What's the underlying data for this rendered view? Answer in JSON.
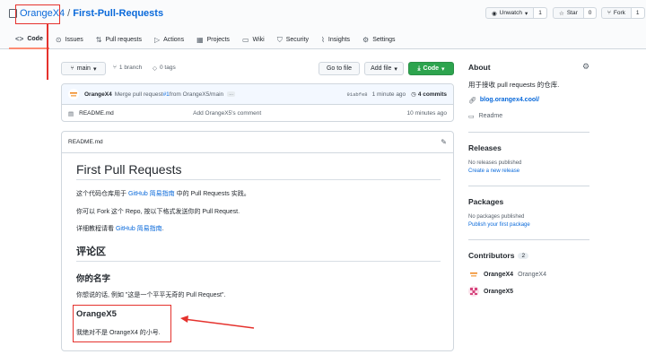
{
  "header": {
    "owner": "OrangeX4",
    "separator": "/",
    "repo": "First-Pull-Requests",
    "unwatch_label": "Unwatch",
    "unwatch_count": "1",
    "star_label": "Star",
    "star_count": "0",
    "fork_label": "Fork",
    "fork_count": "1"
  },
  "tabs": [
    {
      "icon": "<>",
      "label": "Code"
    },
    {
      "icon": "⊙",
      "label": "Issues"
    },
    {
      "icon": "⇅",
      "label": "Pull requests"
    },
    {
      "icon": "▷",
      "label": "Actions"
    },
    {
      "icon": "▦",
      "label": "Projects"
    },
    {
      "icon": "▭",
      "label": "Wiki"
    },
    {
      "icon": "⛉",
      "label": "Security"
    },
    {
      "icon": "⌇",
      "label": "Insights"
    },
    {
      "icon": "⚙",
      "label": "Settings"
    }
  ],
  "toolbar": {
    "branch": "main",
    "branch_count": "1 branch",
    "tags": "0 tags",
    "goto_file": "Go to file",
    "add_file": "Add file",
    "code": "Code"
  },
  "commit": {
    "author": "OrangeX4",
    "message_pre": "Merge pull request ",
    "pr": "#1",
    "message_post": " from OrangeX5/main",
    "ellipsis": "…",
    "sha": "91abfe8",
    "time": "1 minute ago",
    "commits": "4 commits"
  },
  "file": {
    "name": "README.md",
    "message": "Add OrangeX5's comment",
    "time": "10 minutes ago"
  },
  "readme": {
    "filename": "README.md",
    "h1": "First Pull Requests",
    "p1_pre": "这个代码仓库用于 ",
    "p1_link": "GitHub 简易指南",
    "p1_post": " 中的 Pull Requests 实践。",
    "p2": "你可以 Fork 这个 Repo, 按以下格式发送你的 Pull Request.",
    "p3_pre": "详细教程请看 ",
    "p3_link": "GitHub 简易指南",
    "p3_post": ".",
    "h2": "评论区",
    "h3a": "你的名字",
    "p4": "你想说的话, 例如 \"这是一个平平无奇的 Pull Request\".",
    "h3b": "OrangeX5",
    "p5": "我绝对不是 OrangeX4 的小号."
  },
  "about": {
    "title": "About",
    "desc": "用于接收 pull requests 的仓库.",
    "link": "blog.orangex4.cool/",
    "readme": "Readme"
  },
  "releases": {
    "title": "Releases",
    "none": "No releases published",
    "create": "Create a new release"
  },
  "packages": {
    "title": "Packages",
    "none": "No packages published",
    "publish": "Publish your first package"
  },
  "contributors": {
    "title": "Contributors",
    "count": "2",
    "list": [
      {
        "login": "OrangeX4",
        "name": "OrangeX4"
      },
      {
        "login": "OrangeX5",
        "name": ""
      }
    ]
  },
  "colors": {
    "link": "#0969da",
    "green": "#2da44e",
    "annotation": "#e5322d",
    "tab_underline": "#fd8c73"
  }
}
